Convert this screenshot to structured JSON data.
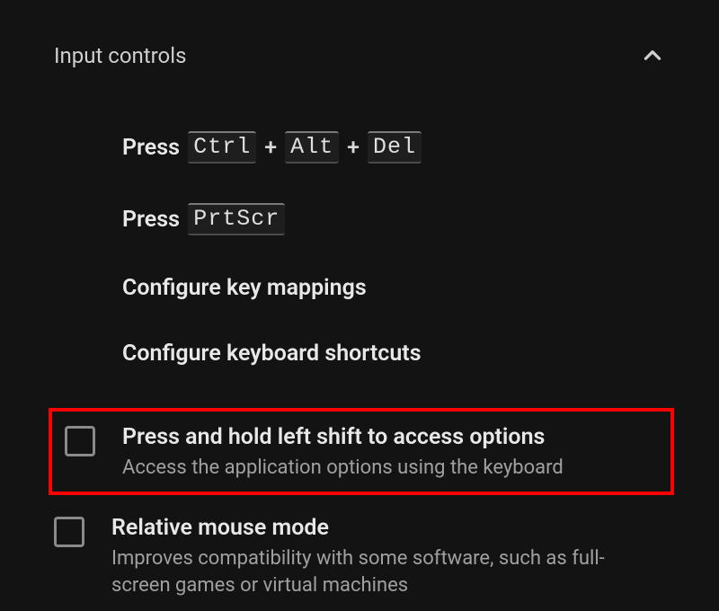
{
  "section": {
    "title": "Input controls"
  },
  "items": {
    "press_ctrl_alt_del": {
      "prefix": "Press",
      "keys": [
        "Ctrl",
        "Alt",
        "Del"
      ]
    },
    "press_prtscr": {
      "prefix": "Press",
      "keys": [
        "PrtScr"
      ]
    },
    "configure_key_mappings": "Configure key mappings",
    "configure_keyboard_shortcuts": "Configure keyboard shortcuts"
  },
  "options": {
    "shift_access": {
      "title": "Press and hold left shift to access options",
      "sub": "Access the application options using the keyboard",
      "checked": false
    },
    "relative_mouse": {
      "title": "Relative mouse mode",
      "sub": "Improves compatibility with some software, such as full-screen games or virtual machines",
      "checked": false
    }
  },
  "glyphs": {
    "plus": "+"
  }
}
